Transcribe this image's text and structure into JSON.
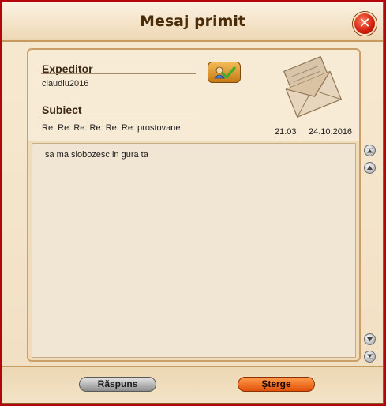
{
  "window": {
    "title": "Mesaj primit",
    "close_icon": "close-icon"
  },
  "message": {
    "sender_label": "Expeditor",
    "sender": "claudiu2016",
    "subject_label": "Subiect",
    "subject": "Re: Re: Re: Re: Re: Re: prostovane",
    "time": "21:03",
    "date": "24.10.2016",
    "body": "sa ma slobozesc in gura ta"
  },
  "footer": {
    "reply_label": "Răspuns",
    "delete_label": "Șterge"
  },
  "colors": {
    "background": "#b4050a",
    "reply_button": "#8e8e8e",
    "delete_button": "#e0520a",
    "verify_check": "#3cae2a"
  }
}
